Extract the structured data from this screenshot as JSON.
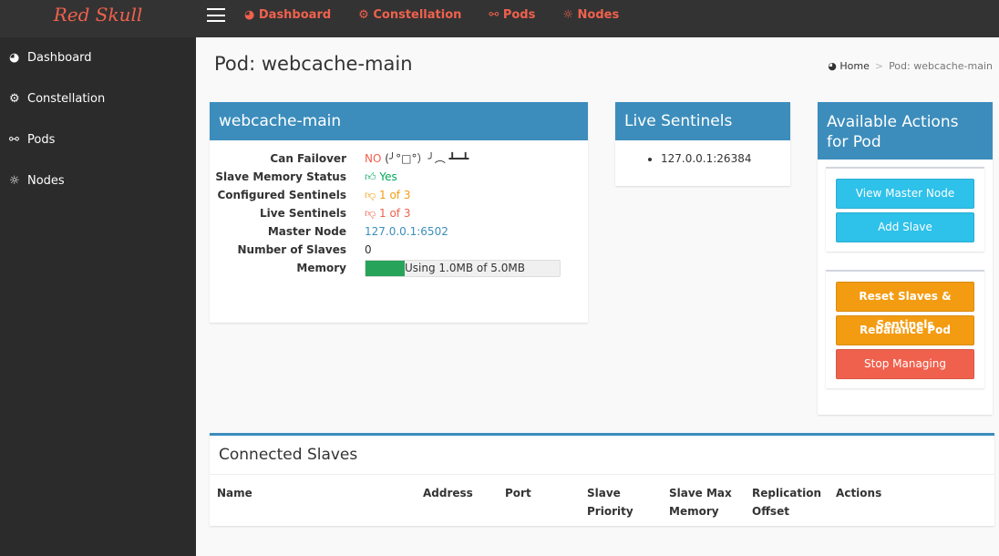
{
  "brand": "Red Skull",
  "topnav": [
    {
      "icon": "dashboard-icon",
      "label": "Dashboard"
    },
    {
      "icon": "cogs-icon",
      "label": "Constellation"
    },
    {
      "icon": "link-icon",
      "label": "Pods"
    },
    {
      "icon": "sun-icon",
      "label": "Nodes"
    }
  ],
  "sidebar": [
    {
      "label": "Dashboard"
    },
    {
      "label": "Constellation"
    },
    {
      "label": "Pods"
    },
    {
      "label": "Nodes"
    }
  ],
  "page_title": "Pod: webcache-main",
  "breadcrumb": {
    "home": "Home",
    "current": "Pod: webcache-main"
  },
  "pod": {
    "title": "webcache-main",
    "can_failover_label": "Can Failover",
    "can_failover": "NO",
    "table_flip": "(╯°□°）╯︵ ┻━┻",
    "slave_mem_label": "Slave Memory Status",
    "slave_mem": "Yes",
    "conf_sent_label": "Configured Sentinels",
    "conf_sent": "1 of 3",
    "live_sent_label": "Live Sentinels",
    "live_sent": "1 of 3",
    "master_label": "Master Node",
    "master": "127.0.0.1:6502",
    "slaves_label": "Number of Slaves",
    "slaves": "0",
    "memory_label": "Memory",
    "memory_text": "Using 1.0MB of 5.0MB",
    "memory_percent": 20
  },
  "sentinels": {
    "title": "Live Sentinels",
    "items": [
      "127.0.0.1:26384"
    ]
  },
  "actions": {
    "title": "Available Actions for Pod",
    "view_master": "View Master Node",
    "add_slave": "Add Slave",
    "reset": "Reset Slaves & Sentinels",
    "rebalance": "Rebalance Pod",
    "stop": "Stop Managing"
  },
  "slaves_table": {
    "title": "Connected Slaves",
    "columns": [
      "Name",
      "Address",
      "Port",
      "Slave Priority",
      "Slave Max Memory",
      "Replication Offset",
      "Actions"
    ]
  }
}
